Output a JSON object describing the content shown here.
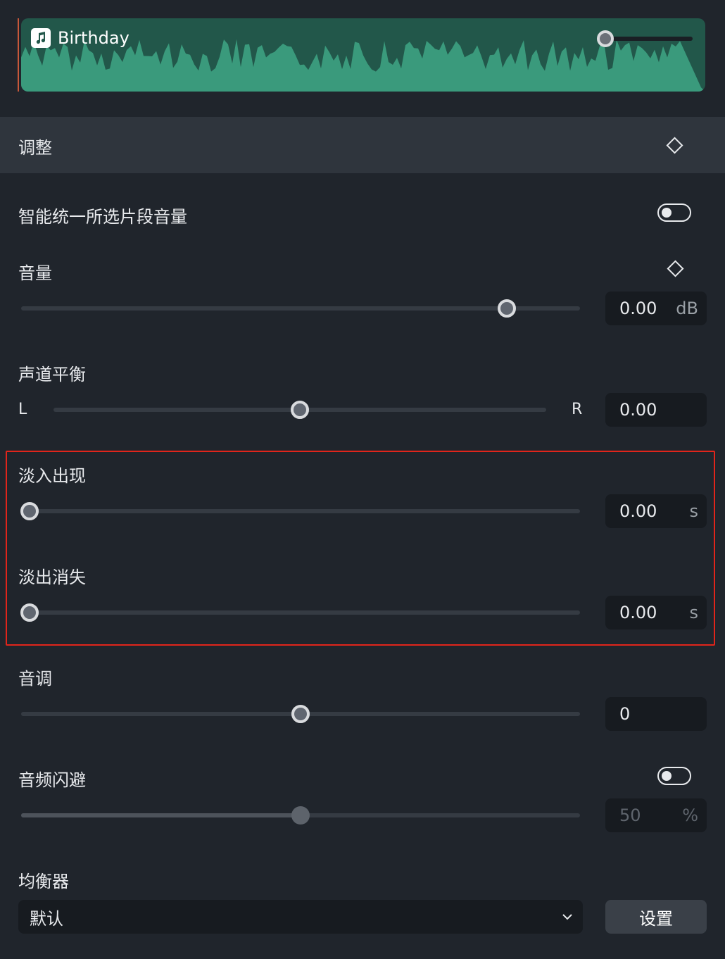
{
  "clip": {
    "name": "Birthday",
    "icon": "music-note-icon",
    "color": "#22574a",
    "wave_color": "#3a9a7c",
    "volume_level": 0.1
  },
  "section": {
    "title": "调整",
    "keyframe_icon": "diamond-icon"
  },
  "smart_volume": {
    "label": "智能统一所选片段音量",
    "enabled": false
  },
  "volume": {
    "label": "音量",
    "value": "0.00",
    "unit": "dB",
    "slider_fraction": 0.88
  },
  "balance": {
    "label": "声道平衡",
    "left_label": "L",
    "right_label": "R",
    "value": "0.00",
    "slider_fraction": 0.5
  },
  "fade_in": {
    "label": "淡入出现",
    "value": "0.00",
    "unit": "s",
    "slider_fraction": 0.0
  },
  "fade_out": {
    "label": "淡出消失",
    "value": "0.00",
    "unit": "s",
    "slider_fraction": 0.0
  },
  "pitch": {
    "label": "音调",
    "value": "0",
    "slider_fraction": 0.5
  },
  "ducking": {
    "label": "音频闪避",
    "enabled": false,
    "value": "50",
    "unit": "%",
    "slider_fraction": 0.5
  },
  "equalizer": {
    "label": "均衡器",
    "selected": "默认",
    "settings_label": "设置"
  },
  "colors": {
    "highlight": "#e1251b",
    "panel_bg": "#20252c",
    "header_bg": "#2f353d"
  }
}
